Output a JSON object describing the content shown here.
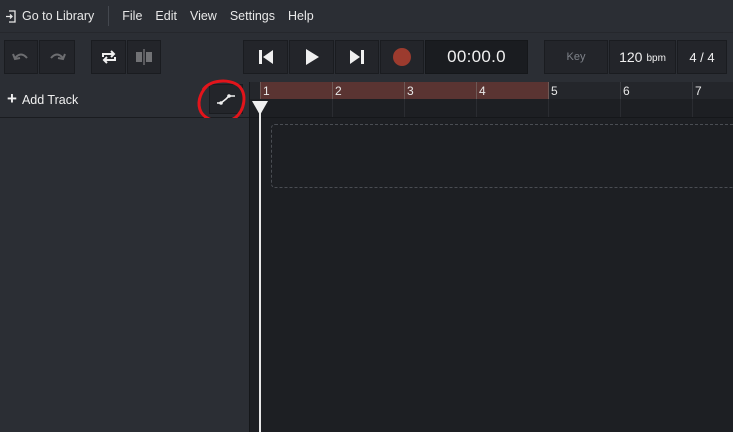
{
  "menubar": {
    "library_label": "Go to Library",
    "items": [
      "File",
      "Edit",
      "View",
      "Settings",
      "Help"
    ]
  },
  "toolbar": {
    "time": "00:00.0",
    "key_label": "Key",
    "bpm_value": "120",
    "bpm_unit": "bpm",
    "time_signature": "4 / 4"
  },
  "tracks": {
    "add_track_label": "Add Track"
  },
  "ruler": {
    "bars": [
      "1",
      "2",
      "3",
      "4",
      "5",
      "6",
      "7"
    ]
  },
  "colors": {
    "background": "#1d1f23",
    "panel": "#2b2e34",
    "loop_region": "#5a3432",
    "record": "#9c3b2e",
    "annotation": "#e2141b"
  }
}
